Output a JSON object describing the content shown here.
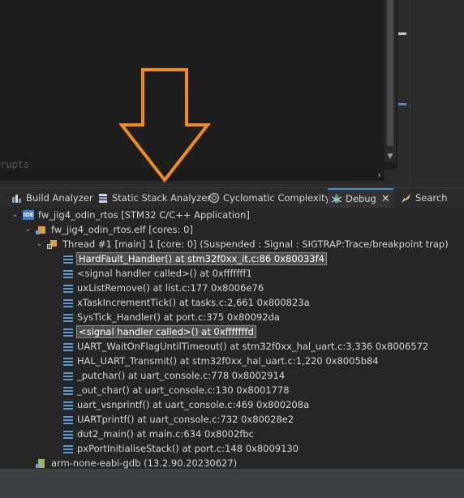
{
  "editor": {
    "ghost_text": "rupts"
  },
  "tabs": [
    {
      "label": "Build Analyzer",
      "icon": "build-analyzer-icon"
    },
    {
      "label": "Static Stack Analyzer",
      "icon": "stack-analyzer-icon"
    },
    {
      "label": "Cyclomatic Complexity",
      "icon": "complexity-icon"
    },
    {
      "label": "Debug",
      "icon": "debug-icon",
      "active": true
    },
    {
      "label": "Search",
      "icon": "search-icon"
    }
  ],
  "debug_tree": {
    "launch": "fw_jig4_odin_rtos [STM32 C/C++ Application]",
    "elf": "fw_jig4_odin_rtos.elf [cores: 0]",
    "thread": "Thread #1 [main] 1 [core: 0] (Suspended : Signal : SIGTRAP:Trace/breakpoint trap)",
    "frames": [
      "HardFault_Handler() at stm32f0xx_it.c:86 0x80033f4",
      "<signal handler called>() at 0xfffffff1",
      "uxListRemove() at list.c:177 0x8006e76",
      "xTaskIncrementTick() at tasks.c:2,661 0x800823a",
      "SysTick_Handler() at port.c:375 0x80092da",
      "<signal handler called>() at 0xfffffffd",
      "UART_WaitOnFlagUntilTimeout() at stm32f0xx_hal_uart.c:3,336 0x8006572",
      "HAL_UART_Transmit() at stm32f0xx_hal_uart.c:1,220 0x8005b84",
      "_putchar() at uart_console.c:778 0x8002914",
      "_out_char() at uart_console.c:130 0x8001778",
      "uart_vsnprintf() at uart_console.c:469 0x800208a",
      "UARTprintf() at uart_console.c:732 0x80028e2",
      "dut2_main() at main.c:634 0x8002fbc",
      "pxPortInitialiseStack() at port.c:148 0x8009130"
    ],
    "gdb": "arm-none-eabi-gdb (13.2.90.20230627)"
  },
  "colors": {
    "accent": "#3c8fd0",
    "annotation_arrow": "#f08a24",
    "frame_icon": "#5b9bd5"
  }
}
